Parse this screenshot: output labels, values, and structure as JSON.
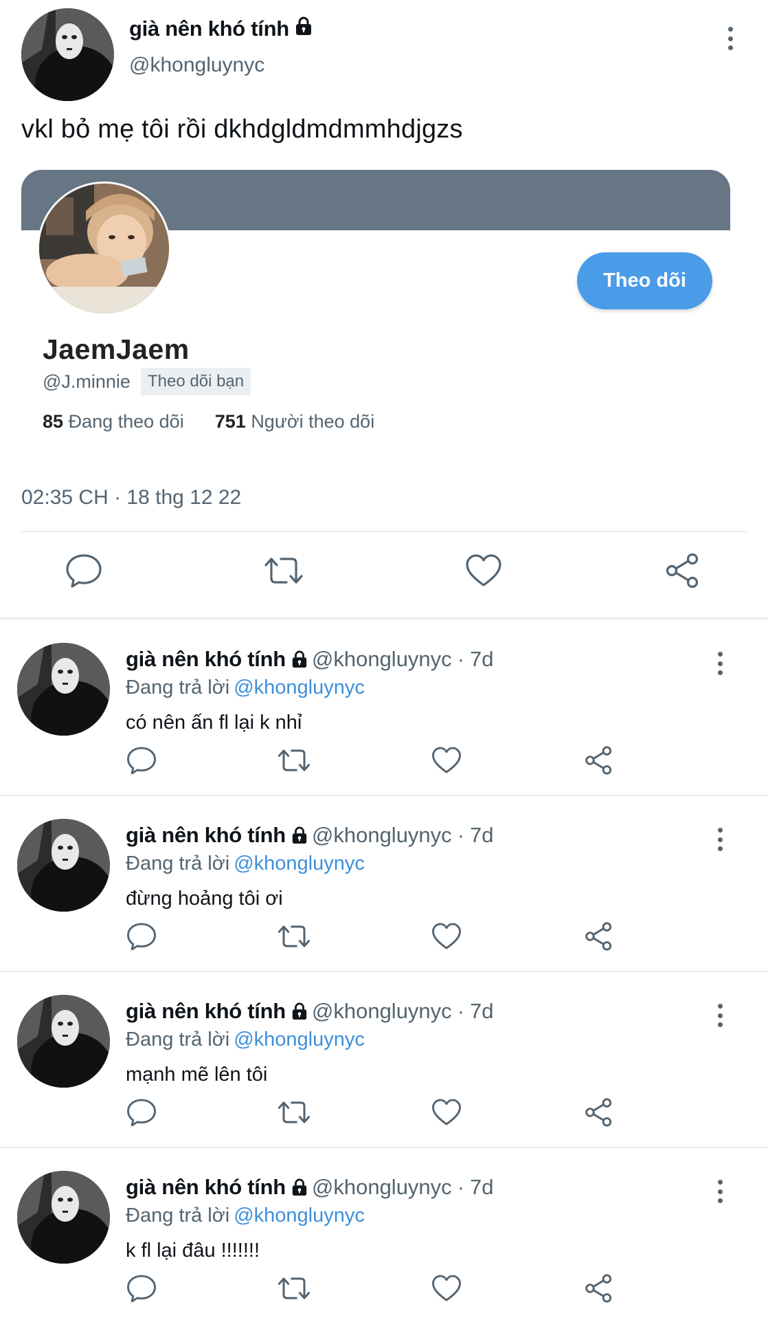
{
  "main_tweet": {
    "author_name": "già nên khó tính",
    "author_handle": "@khongluynyc",
    "text": "vkl bỏ mẹ tôi rồi dkhdgldmdmmhdjgzs",
    "timestamp": "02:35 CH · 18 thg 12 22",
    "profile_card": {
      "name": "JaemJaem",
      "handle": "@J.minnie",
      "follows_you_badge": "Theo dõi bạn",
      "follow_button_label": "Theo dõi",
      "following_count": "85",
      "following_label": "Đang theo dõi",
      "followers_count": "751",
      "followers_label": "Người theo dõi"
    },
    "actions": [
      "reply-icon",
      "retweet-icon",
      "like-icon",
      "share-icon"
    ]
  },
  "replies": [
    {
      "author_name": "già nên khó tính",
      "author_handle": "@khongluynyc",
      "separator": "·",
      "time": "7d",
      "replying_label": "Đang trả lời",
      "replying_to": "@khongluynyc",
      "text": "có nên ấn fl lại k nhỉ"
    },
    {
      "author_name": "già nên khó tính",
      "author_handle": "@khongluynyc",
      "separator": "·",
      "time": "7d",
      "replying_label": "Đang trả lời",
      "replying_to": "@khongluynyc",
      "text": "đừng hoảng tôi ơi"
    },
    {
      "author_name": "già nên khó tính",
      "author_handle": "@khongluynyc",
      "separator": "·",
      "time": "7d",
      "replying_label": "Đang trả lời",
      "replying_to": "@khongluynyc",
      "text": "mạnh mẽ lên tôi"
    },
    {
      "author_name": "già nên khó tính",
      "author_handle": "@khongluynyc",
      "separator": "·",
      "time": "7d",
      "replying_label": "Đang trả lời",
      "replying_to": "@khongluynyc",
      "text": "k fl lại đâu !!!!!!!"
    }
  ],
  "colors": {
    "accent_blue": "#4a9be8",
    "link_blue": "#3d8fdb",
    "banner": "#677684",
    "secondary_text": "#536471"
  }
}
